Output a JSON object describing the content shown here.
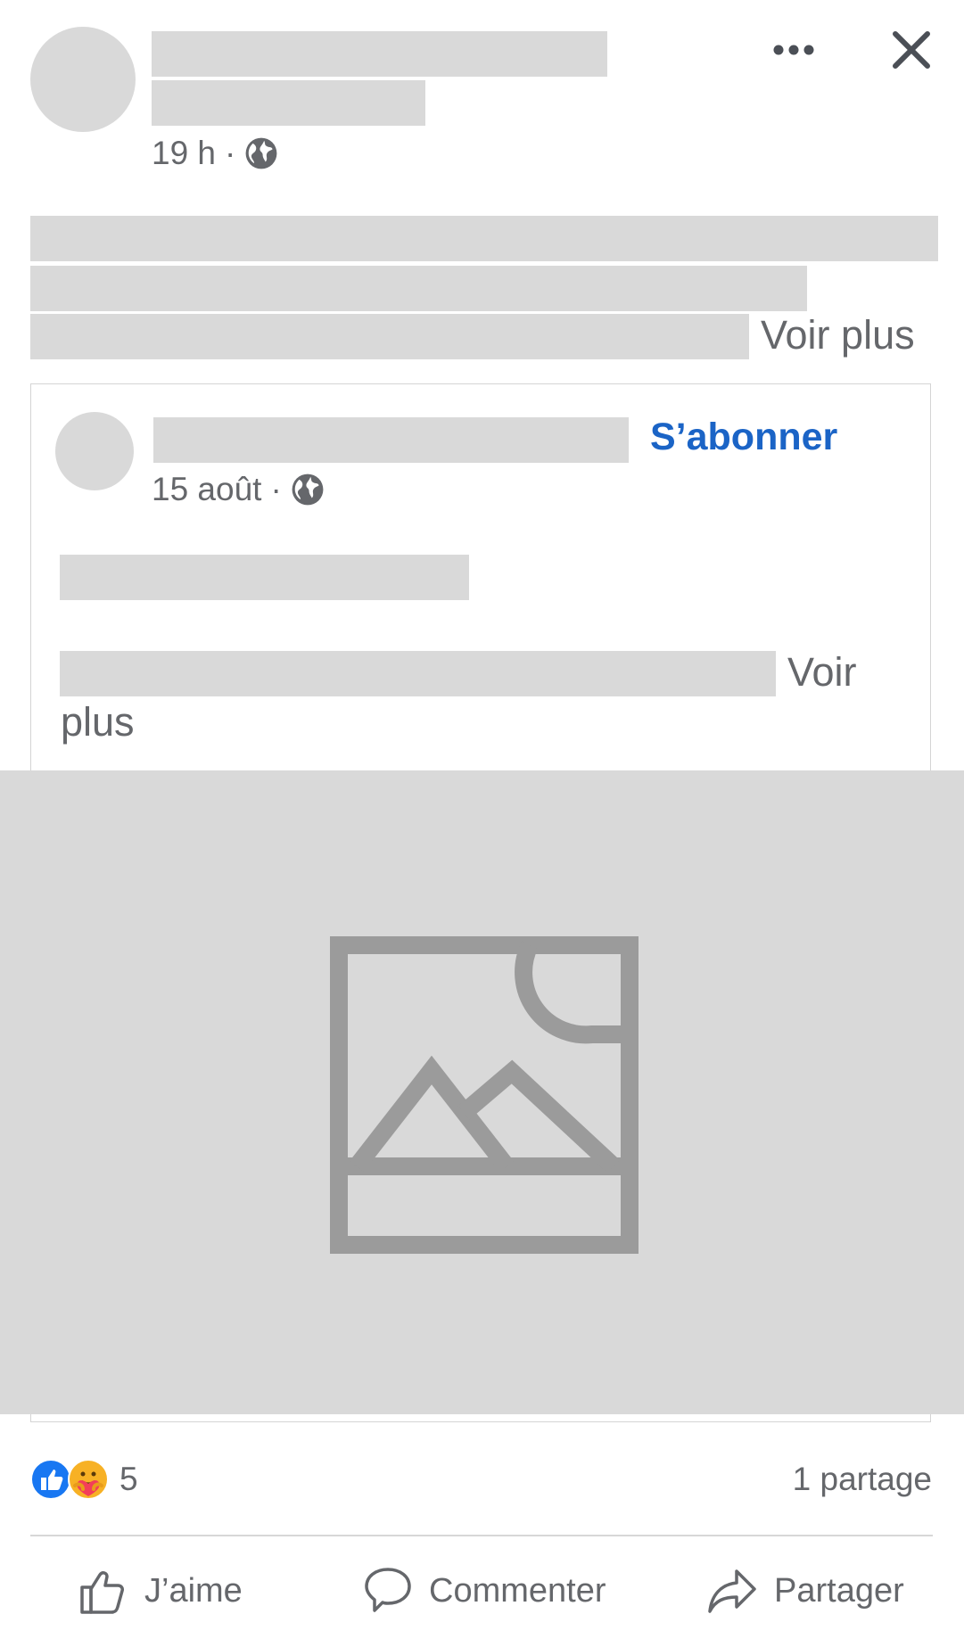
{
  "post": {
    "time": "19 h",
    "separator": "·",
    "see_more": "Voir plus"
  },
  "shared_post": {
    "follow_label": "S’abonner",
    "date": "15 août",
    "separator": "·",
    "see_more_line1": "Voir",
    "see_more_line2": "plus"
  },
  "reactions": {
    "count": "5",
    "shares": "1 partage",
    "icons": [
      "like-reaction",
      "care-reaction"
    ]
  },
  "actions": {
    "like": "J’aime",
    "comment": "Commenter",
    "share": "Partager"
  },
  "colors": {
    "placeholder": "#d9d9d9",
    "link_blue": "#1b64c6",
    "text_gray": "#65676b",
    "like_blue": "#1877f2"
  }
}
